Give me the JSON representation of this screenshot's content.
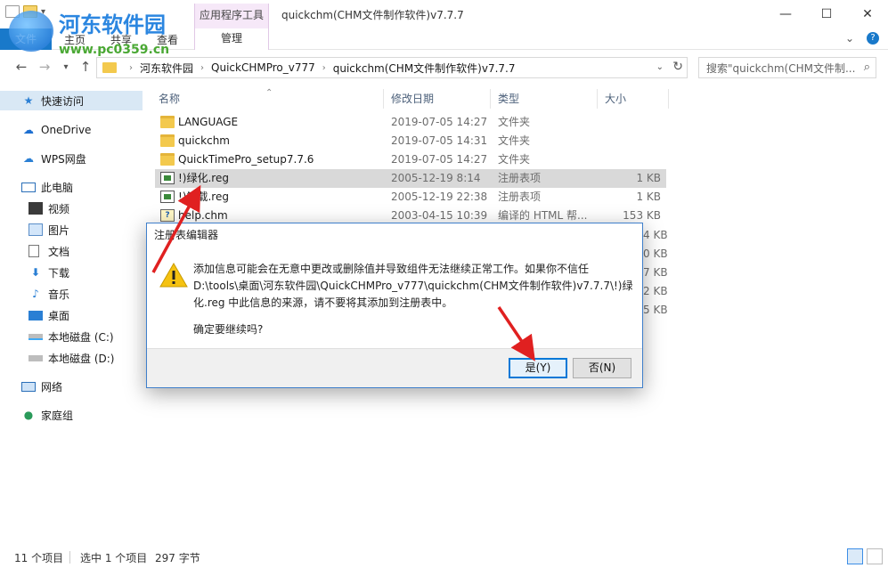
{
  "window": {
    "tool_tab": "应用程序工具",
    "title": "quickchm(CHM文件制作软件)v7.7.7",
    "min": "—",
    "max": "☐",
    "close": "✕"
  },
  "ribbon": {
    "file": "文件",
    "home": "主页",
    "share": "共享",
    "view": "查看",
    "manage": "管理"
  },
  "watermark": {
    "title": "河东软件园",
    "url": "www.pc0359.cn"
  },
  "address": {
    "crumbs": [
      "河东软件园",
      "QuickCHMPro_v777",
      "quickchm(CHM文件制作软件)v7.7.7"
    ],
    "search_placeholder": "搜索\"quickchm(CHM文件制..."
  },
  "sidebar": {
    "items": [
      {
        "label": "快速访问",
        "icon": "star-icon"
      },
      {
        "label": "OneDrive",
        "icon": "cloud-icon"
      },
      {
        "label": "WPS网盘",
        "icon": "wps-cloud-icon"
      },
      {
        "label": "此电脑",
        "icon": "computer-icon"
      },
      {
        "label": "视频",
        "icon": "video-icon"
      },
      {
        "label": "图片",
        "icon": "picture-icon"
      },
      {
        "label": "文档",
        "icon": "document-icon"
      },
      {
        "label": "下载",
        "icon": "download-icon"
      },
      {
        "label": "音乐",
        "icon": "music-icon"
      },
      {
        "label": "桌面",
        "icon": "desktop-icon"
      },
      {
        "label": "本地磁盘 (C:)",
        "icon": "drive-icon"
      },
      {
        "label": "本地磁盘 (D:)",
        "icon": "drive-icon"
      },
      {
        "label": "网络",
        "icon": "network-icon"
      },
      {
        "label": "家庭组",
        "icon": "homegroup-icon"
      }
    ]
  },
  "columns": {
    "name": "名称",
    "date": "修改日期",
    "type": "类型",
    "size": "大小"
  },
  "files": [
    {
      "name": "LANGUAGE",
      "date": "2019-07-05 14:27",
      "type": "文件夹",
      "size": "",
      "icon": "folder-icon"
    },
    {
      "name": "quickchm",
      "date": "2019-07-05 14:31",
      "type": "文件夹",
      "size": "",
      "icon": "folder-icon"
    },
    {
      "name": "QuickTimePro_setup7.7.6",
      "date": "2019-07-05 14:27",
      "type": "文件夹",
      "size": "",
      "icon": "folder-icon"
    },
    {
      "name": "!)绿化.reg",
      "date": "2005-12-19 8:14",
      "type": "注册表项",
      "size": "1 KB",
      "icon": "registry-file-icon"
    },
    {
      "name": "!)卸载.reg",
      "date": "2005-12-19 22:38",
      "type": "注册表项",
      "size": "1 KB",
      "icon": "registry-file-icon"
    },
    {
      "name": "help.chm",
      "date": "2003-04-15 10:39",
      "type": "编译的 HTML 帮...",
      "size": "153 KB",
      "icon": "chm-file-icon"
    }
  ],
  "hidden_sizes": [
    "4 KB",
    "0 KB",
    "7 KB",
    "2 KB",
    "5 KB"
  ],
  "status": {
    "count": "11 个项目",
    "selected": "选中 1 个项目",
    "size": "297 字节"
  },
  "dialog": {
    "title": "注册表编辑器",
    "message": "添加信息可能会在无意中更改或删除值并导致组件无法继续正常工作。如果你不信任 D:\\tools\\桌面\\河东软件园\\QuickCHMPro_v777\\quickchm(CHM文件制作软件)v7.7.7\\!)绿化.reg 中此信息的来源，请不要将其添加到注册表中。",
    "confirm": "确定要继续吗?",
    "yes": "是(Y)",
    "no": "否(N)"
  },
  "colors": {
    "accent": "#1979ca",
    "selection": "#d9e8f5",
    "annotation_arrow": "#e02020"
  }
}
